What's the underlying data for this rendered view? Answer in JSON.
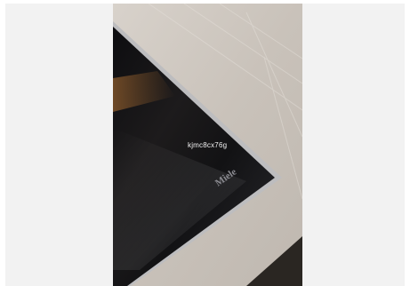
{
  "photo": {
    "brand_logo_text": "Miele",
    "watermark_text": "kjmc8cx76g"
  },
  "colors": {
    "background": "#f2f2f2",
    "countertop": "#cdc6be",
    "glass": "#141416",
    "steel_trim": "#b9b9bb",
    "cabinet": "#2a2622"
  }
}
